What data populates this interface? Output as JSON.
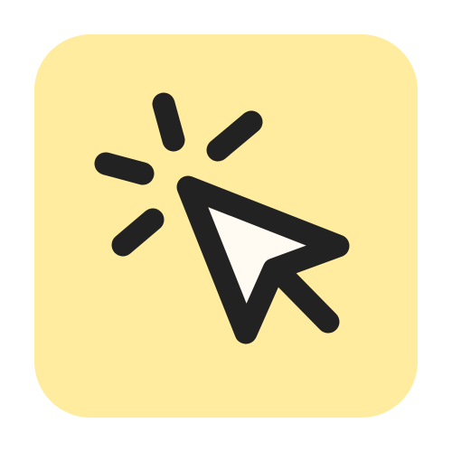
{
  "icon": {
    "name": "click-cursor-icon",
    "background_color": "#FFEC9E",
    "stroke_color": "#222222",
    "cursor_fill_color": "#FFFBF2"
  }
}
